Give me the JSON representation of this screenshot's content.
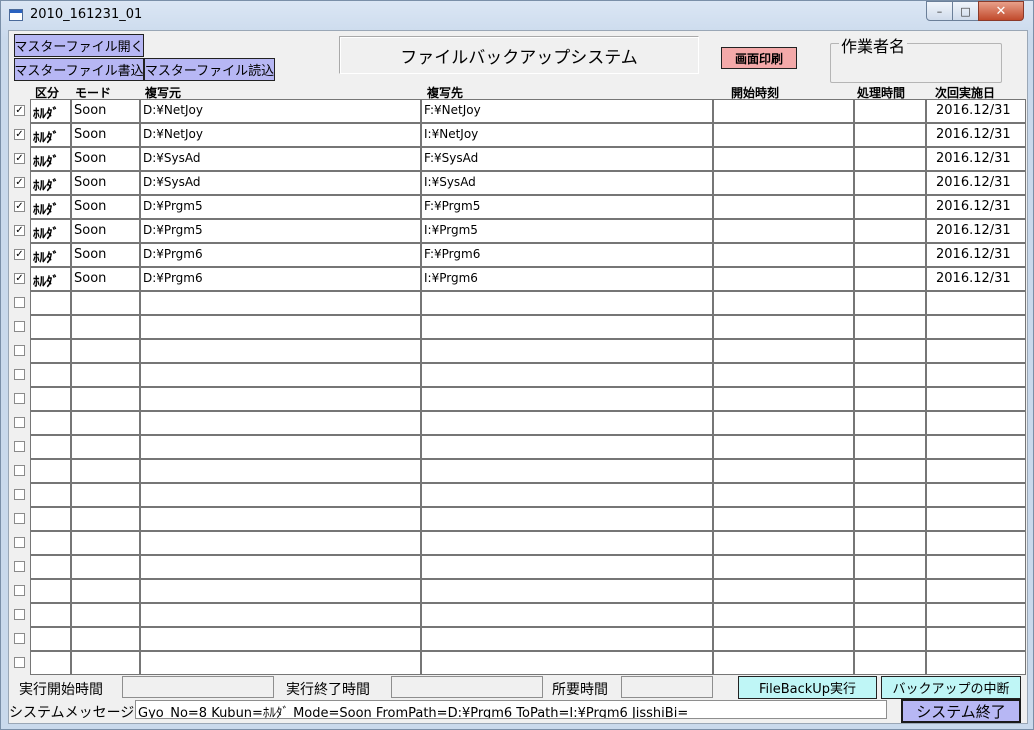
{
  "window": {
    "title": "2010_161231_01"
  },
  "toolbar": {
    "open_master": "マスターファイル開く",
    "write_master": "マスターファイル書込",
    "read_master": "マスターファイル読込",
    "print_screen": "画面印刷"
  },
  "system_title": "ファイルバックアップシステム",
  "worker_group_label": "作業者名",
  "table": {
    "headers": {
      "kubun": "区分",
      "mode": "モード",
      "from": "複写元",
      "to": "複写先",
      "start": "開始時刻",
      "proc": "処理時間",
      "next": "次回実施日"
    },
    "rows": [
      {
        "checked": true,
        "kubun": "ﾎﾙﾀﾞ",
        "mode": "Soon",
        "from": "D:¥NetJoy",
        "to": "F:¥NetJoy",
        "start": "",
        "proc": "",
        "next": "2016.12/31"
      },
      {
        "checked": true,
        "kubun": "ﾎﾙﾀﾞ",
        "mode": "Soon",
        "from": "D:¥NetJoy",
        "to": "I:¥NetJoy",
        "start": "",
        "proc": "",
        "next": "2016.12/31"
      },
      {
        "checked": true,
        "kubun": "ﾎﾙﾀﾞ",
        "mode": "Soon",
        "from": "D:¥SysAd",
        "to": "F:¥SysAd",
        "start": "",
        "proc": "",
        "next": "2016.12/31"
      },
      {
        "checked": true,
        "kubun": "ﾎﾙﾀﾞ",
        "mode": "Soon",
        "from": "D:¥SysAd",
        "to": "I:¥SysAd",
        "start": "",
        "proc": "",
        "next": "2016.12/31"
      },
      {
        "checked": true,
        "kubun": "ﾎﾙﾀﾞ",
        "mode": "Soon",
        "from": "D:¥Prgm5",
        "to": "F:¥Prgm5",
        "start": "",
        "proc": "",
        "next": "2016.12/31"
      },
      {
        "checked": true,
        "kubun": "ﾎﾙﾀﾞ",
        "mode": "Soon",
        "from": "D:¥Prgm5",
        "to": "I:¥Prgm5",
        "start": "",
        "proc": "",
        "next": "2016.12/31"
      },
      {
        "checked": true,
        "kubun": "ﾎﾙﾀﾞ",
        "mode": "Soon",
        "from": "D:¥Prgm6",
        "to": "F:¥Prgm6",
        "start": "",
        "proc": "",
        "next": "2016.12/31"
      },
      {
        "checked": true,
        "kubun": "ﾎﾙﾀﾞ",
        "mode": "Soon",
        "from": "D:¥Prgm6",
        "to": "I:¥Prgm6",
        "start": "",
        "proc": "",
        "next": "2016.12/31"
      },
      {
        "checked": false,
        "kubun": "",
        "mode": "",
        "from": "",
        "to": "",
        "start": "",
        "proc": "",
        "next": ""
      },
      {
        "checked": false,
        "kubun": "",
        "mode": "",
        "from": "",
        "to": "",
        "start": "",
        "proc": "",
        "next": ""
      },
      {
        "checked": false,
        "kubun": "",
        "mode": "",
        "from": "",
        "to": "",
        "start": "",
        "proc": "",
        "next": ""
      },
      {
        "checked": false,
        "kubun": "",
        "mode": "",
        "from": "",
        "to": "",
        "start": "",
        "proc": "",
        "next": ""
      },
      {
        "checked": false,
        "kubun": "",
        "mode": "",
        "from": "",
        "to": "",
        "start": "",
        "proc": "",
        "next": ""
      },
      {
        "checked": false,
        "kubun": "",
        "mode": "",
        "from": "",
        "to": "",
        "start": "",
        "proc": "",
        "next": ""
      },
      {
        "checked": false,
        "kubun": "",
        "mode": "",
        "from": "",
        "to": "",
        "start": "",
        "proc": "",
        "next": ""
      },
      {
        "checked": false,
        "kubun": "",
        "mode": "",
        "from": "",
        "to": "",
        "start": "",
        "proc": "",
        "next": ""
      },
      {
        "checked": false,
        "kubun": "",
        "mode": "",
        "from": "",
        "to": "",
        "start": "",
        "proc": "",
        "next": ""
      },
      {
        "checked": false,
        "kubun": "",
        "mode": "",
        "from": "",
        "to": "",
        "start": "",
        "proc": "",
        "next": ""
      },
      {
        "checked": false,
        "kubun": "",
        "mode": "",
        "from": "",
        "to": "",
        "start": "",
        "proc": "",
        "next": ""
      },
      {
        "checked": false,
        "kubun": "",
        "mode": "",
        "from": "",
        "to": "",
        "start": "",
        "proc": "",
        "next": ""
      },
      {
        "checked": false,
        "kubun": "",
        "mode": "",
        "from": "",
        "to": "",
        "start": "",
        "proc": "",
        "next": ""
      },
      {
        "checked": false,
        "kubun": "",
        "mode": "",
        "from": "",
        "to": "",
        "start": "",
        "proc": "",
        "next": ""
      },
      {
        "checked": false,
        "kubun": "",
        "mode": "",
        "from": "",
        "to": "",
        "start": "",
        "proc": "",
        "next": ""
      },
      {
        "checked": false,
        "kubun": "",
        "mode": "",
        "from": "",
        "to": "",
        "start": "",
        "proc": "",
        "next": ""
      }
    ]
  },
  "footer": {
    "start_time_label": "実行開始時間",
    "end_time_label": "実行終了時間",
    "elapsed_label": "所要時間",
    "run_button": "FileBackUp実行",
    "abort_button": "バックアップの中断",
    "message_label": "システムメッセージ",
    "message_text": "Gyo_No=8  Kubun=ﾎﾙﾀﾞ  Mode=Soon  FromPath=D:¥Prgm6  ToPath=I:¥Prgm6  JisshiBi=",
    "exit_button": "システム終了"
  },
  "icons": [
    "app-icon",
    "minimize-icon",
    "maximize-icon",
    "close-icon",
    "checkbox-icon"
  ]
}
